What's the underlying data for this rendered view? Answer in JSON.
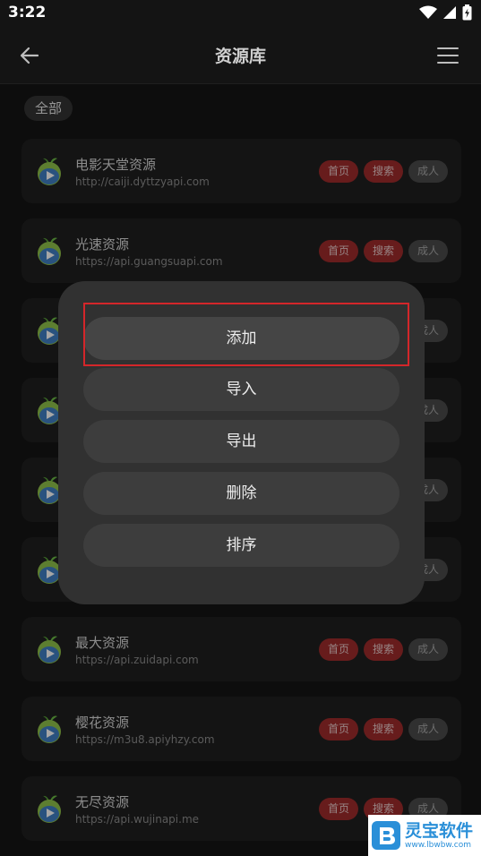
{
  "status_bar": {
    "time": "3:22"
  },
  "app_bar": {
    "title": "资源库"
  },
  "filter": {
    "chip_label": "全部"
  },
  "sources": [
    {
      "name": "电影天堂资源",
      "url": "http://caiji.dyttzyapi.com",
      "tags": [
        "首页",
        "搜索",
        "成人"
      ]
    },
    {
      "name": "光速资源",
      "url": "https://api.guangsuapi.com",
      "tags": [
        "首页",
        "搜索",
        "成人"
      ]
    },
    {
      "name": "",
      "url": "",
      "tags": [
        "",
        "",
        "成人"
      ]
    },
    {
      "name": "",
      "url": "",
      "tags": [
        "",
        "",
        "成人"
      ]
    },
    {
      "name": "",
      "url": "",
      "tags": [
        "",
        "",
        "成人"
      ]
    },
    {
      "name": "",
      "url": "",
      "tags": [
        "",
        "",
        "成人"
      ]
    },
    {
      "name": "最大资源",
      "url": "https://api.zuidapi.com",
      "tags": [
        "首页",
        "搜索",
        "成人"
      ]
    },
    {
      "name": "樱花资源",
      "url": "https://m3u8.apiyhzy.com",
      "tags": [
        "首页",
        "搜索",
        "成人"
      ]
    },
    {
      "name": "无尽资源",
      "url": "https://api.wujinapi.me",
      "tags": [
        "首页",
        "搜索",
        "成人"
      ]
    }
  ],
  "popup_menu": {
    "items": [
      "添加",
      "导入",
      "导出",
      "删除",
      "排序"
    ]
  },
  "watermark": {
    "title": "灵宝软件",
    "url": "www.lbwbw.com"
  },
  "colors": {
    "background": "#141414",
    "card": "#1f1f1f",
    "tag_red": "#9f2c2c",
    "tag_gray": "#4a4a4a",
    "popup": "#313131",
    "highlight": "#d4262a"
  },
  "icons": {
    "back": "arrow-left-icon",
    "menu": "hamburger-icon",
    "logo": "apple-play-icon",
    "wifi": "wifi-icon",
    "signal": "signal-icon",
    "battery": "battery-icon"
  }
}
